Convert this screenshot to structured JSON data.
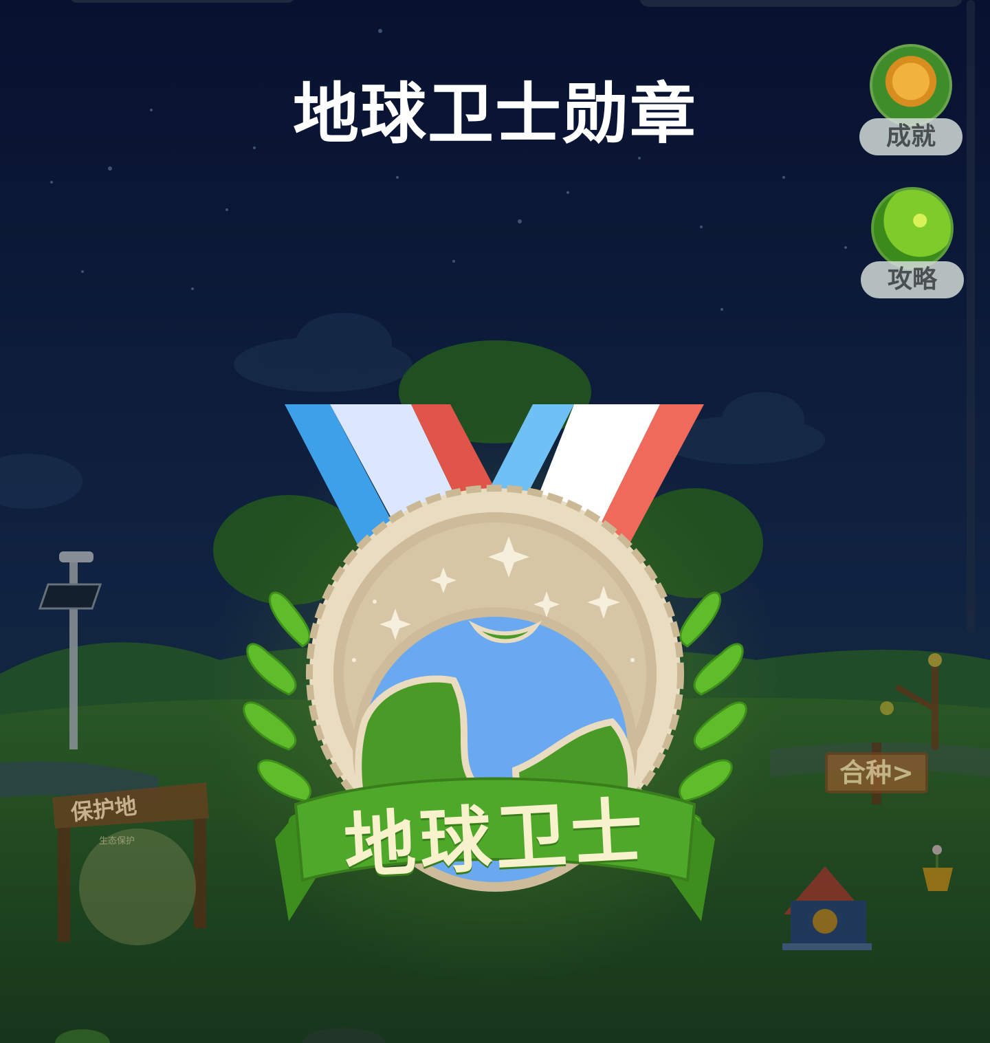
{
  "overlay": {
    "title": "地球卫士勋章"
  },
  "side_buttons": [
    {
      "label": "成就",
      "icon": "achievement-medal-icon"
    },
    {
      "label": "攻略",
      "icon": "guide-orb-icon"
    }
  ],
  "scene": {
    "plant_sign": "合种>",
    "gate_sign": "保护地",
    "gate_subtitle": "生态保护"
  },
  "medal": {
    "text": "地球卫士",
    "colors": {
      "ribbon_blue": "#3fa0ea",
      "ribbon_light": "#dbe7ff",
      "ribbon_red": "#e0554a",
      "medal_gold": "#e3d2b4",
      "leaf_green": "#5fbd2b",
      "banner_green": "#4ea82a",
      "ocean": "#6aa9f0"
    }
  },
  "colors": {
    "sky_top": "#0e1c4e",
    "sky_bottom": "#1c3a5c",
    "grass": "#2f6b31"
  }
}
